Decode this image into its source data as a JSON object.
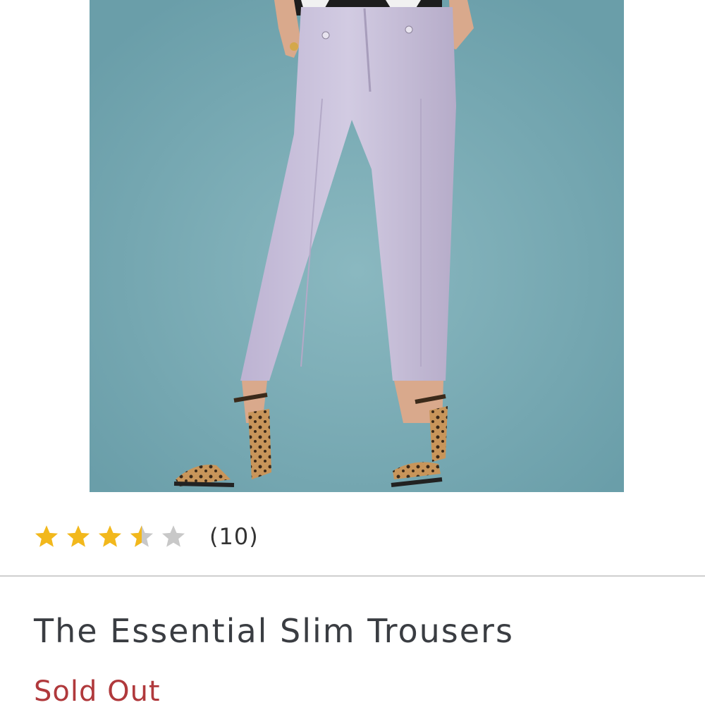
{
  "product": {
    "image_alt": "Model wearing lavender slim trousers with leopard heeled sandals",
    "title": "The Essential Slim Trousers",
    "stock_status": "Sold Out"
  },
  "rating": {
    "value": 3.5,
    "max": 5,
    "review_count_label": "(10)"
  },
  "colors": {
    "star_filled": "#f2b81c",
    "star_empty": "#c8c8c8",
    "sold_out": "#b0393c",
    "image_background": "#78a9b3",
    "trouser": "#c9c1da"
  }
}
